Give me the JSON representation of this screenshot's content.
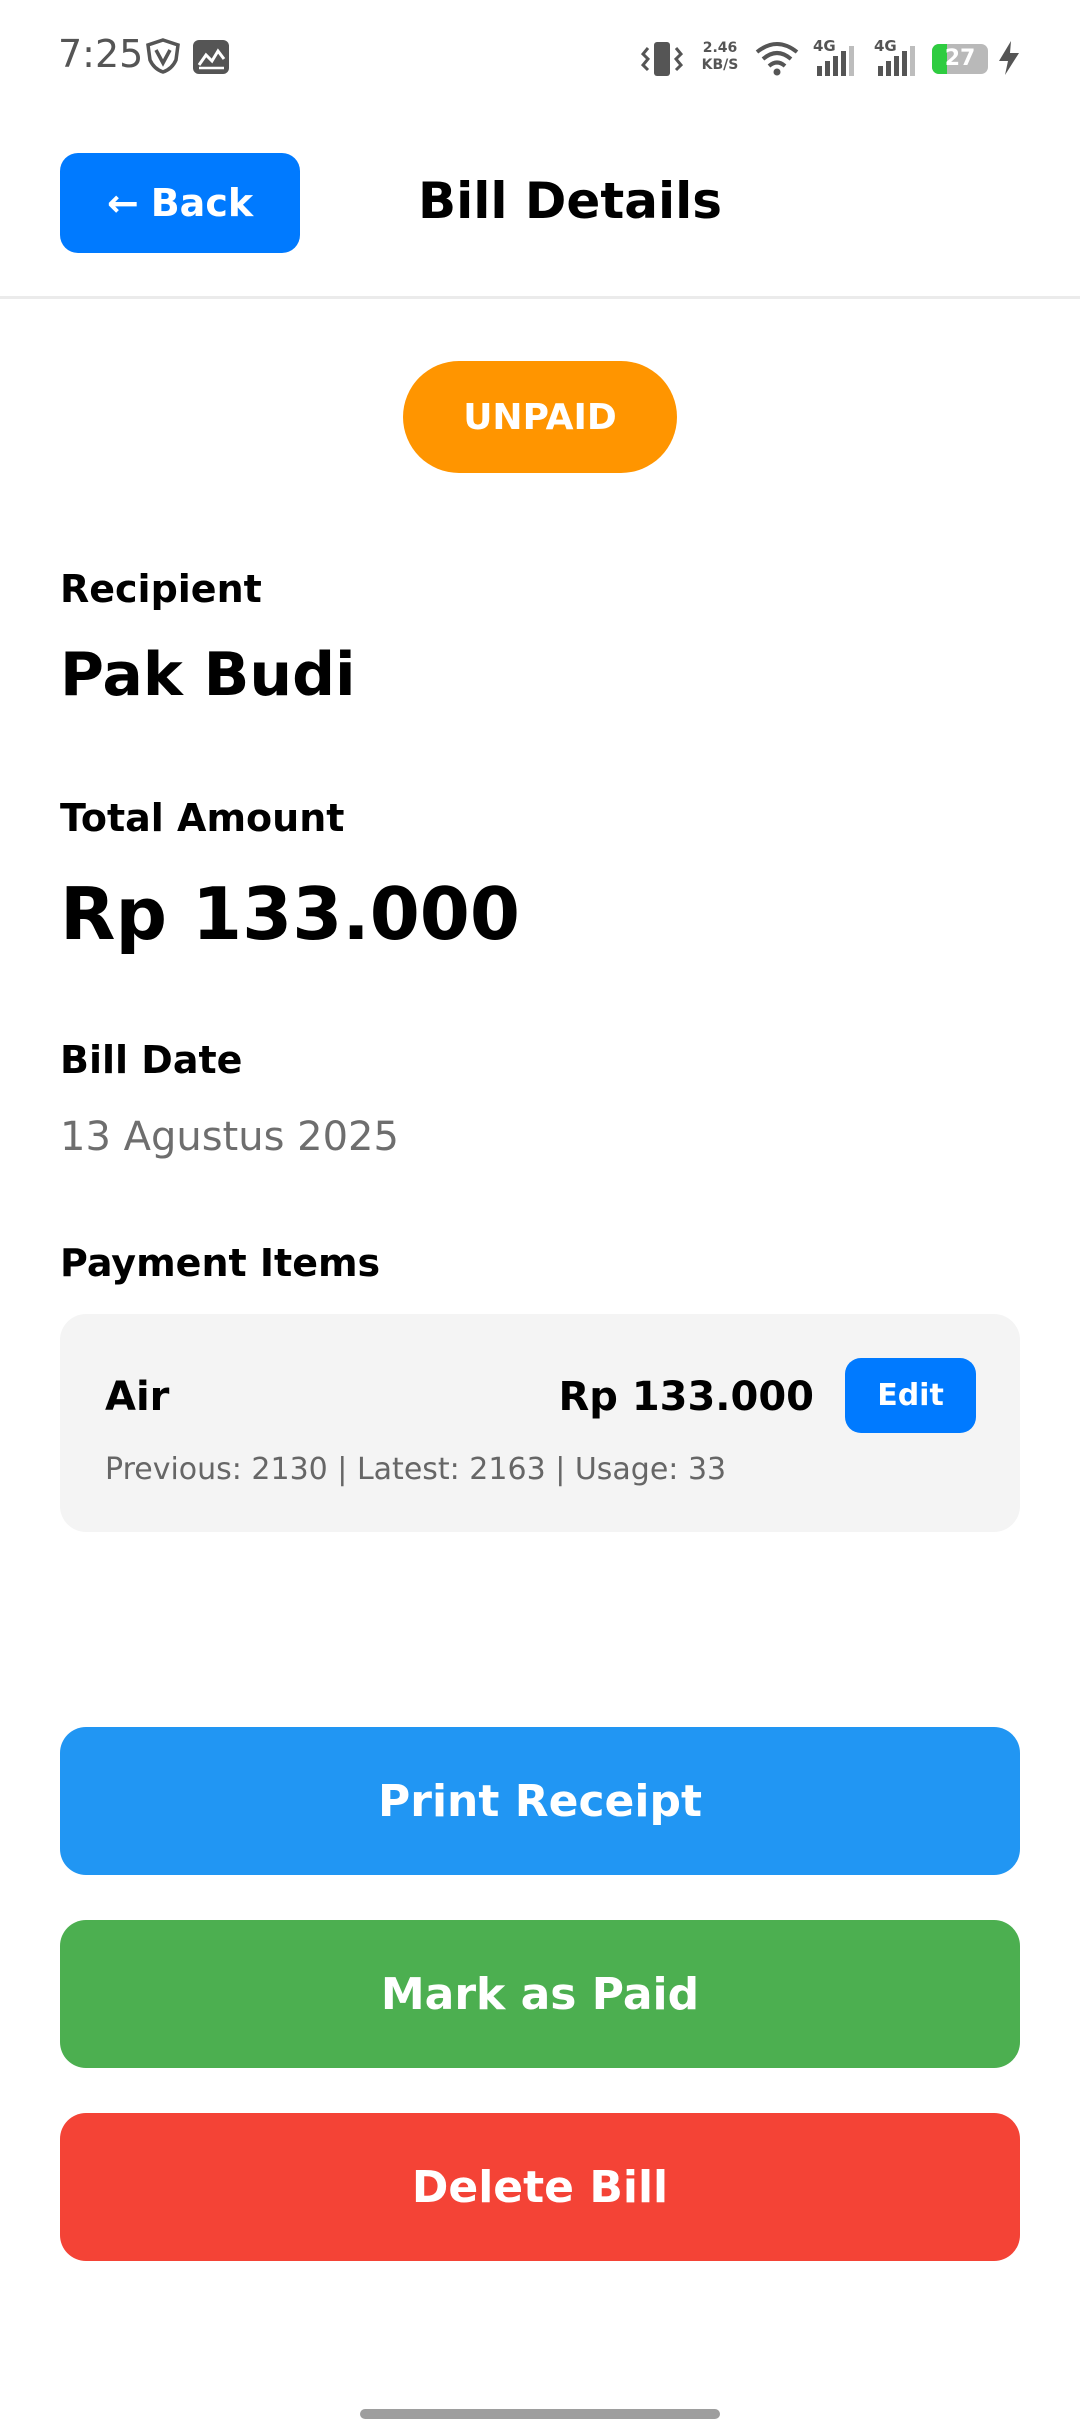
{
  "status_bar": {
    "time": "7:25",
    "net_speed_value": "2.46",
    "net_speed_unit": "KB/S",
    "signal1_label": "4G",
    "signal2_label": "4G",
    "battery_level": "27",
    "battery_fraction": 0.27,
    "icons": [
      "vpn-shield-icon",
      "gallery-icon",
      "vibrate-icon",
      "wifi-icon",
      "signal-icon",
      "battery-icon",
      "charging-icon"
    ]
  },
  "header": {
    "back_arrow": "←",
    "back_label": "Back",
    "title": "Bill Details"
  },
  "bill": {
    "status": "UNPAID",
    "recipient_label": "Recipient",
    "recipient": "Pak Budi",
    "total_label": "Total Amount",
    "total": "Rp 133.000",
    "date_label": "Bill Date",
    "date": "13 Agustus 2025",
    "items_label": "Payment Items",
    "items": [
      {
        "name": "Air",
        "amount": "Rp 133.000",
        "edit_label": "Edit",
        "details": "Previous: 2130 | Latest: 2163 | Usage: 33"
      }
    ]
  },
  "actions": {
    "print_label": "Print Receipt",
    "paid_label": "Mark as Paid",
    "delete_label": "Delete Bill"
  },
  "colors": {
    "primary": "#007aff",
    "status_unpaid": "#ff9500",
    "print": "#2196f3",
    "paid": "#4caf50",
    "delete": "#f44336"
  }
}
